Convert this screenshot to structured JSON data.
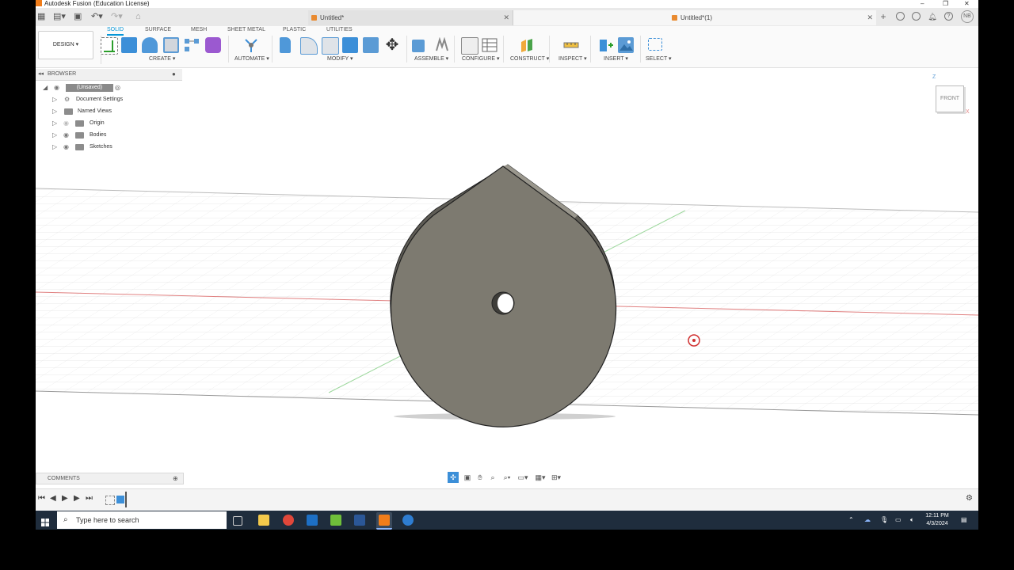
{
  "window": {
    "title": "Autodesk Fusion (Education License)",
    "controls": [
      "–",
      "❐",
      "✕"
    ]
  },
  "tabs": [
    {
      "label": "Untitled*",
      "active": false
    },
    {
      "label": "Untitled*(1)",
      "active": true
    }
  ],
  "user_initials": "NB",
  "toolbar": {
    "workspace": "DESIGN ▾",
    "workspace_tabs": [
      "SOLID",
      "SURFACE",
      "MESH",
      "SHEET METAL",
      "PLASTIC",
      "UTILITIES"
    ],
    "active_workspace_tab": "SOLID",
    "groups": [
      "CREATE ▾",
      "AUTOMATE ▾",
      "MODIFY ▾",
      "ASSEMBLE ▾",
      "CONFIGURE ▾",
      "CONSTRUCT ▾",
      "INSPECT ▾",
      "INSERT ▾",
      "SELECT ▾"
    ]
  },
  "browser": {
    "title": "BROWSER",
    "root": "(Unsaved)",
    "items": [
      "Document Settings",
      "Named Views",
      "Origin",
      "Bodies",
      "Sketches"
    ]
  },
  "viewcube": {
    "face": "FRONT",
    "axis_z": "Z",
    "axis_x": "X"
  },
  "comments": {
    "title": "COMMENTS"
  },
  "taskbar": {
    "search_placeholder": "Type here to search",
    "time": "12:11 PM",
    "date": "4/3/2024"
  },
  "colors": {
    "accent": "#0696d7",
    "body_fill": "#7d7a70",
    "taskbar": "#1f2d3d",
    "fusion_orange": "#f07d1a"
  }
}
